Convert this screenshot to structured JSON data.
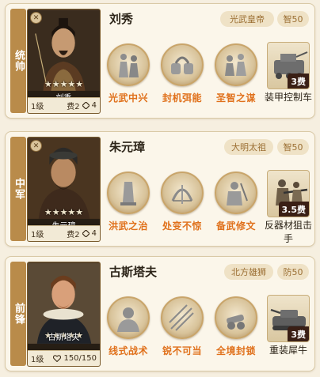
{
  "generals": [
    {
      "position": "统帅",
      "name": "刘秀",
      "stars": "★★★★★",
      "level": "1级",
      "cost_text": "费2",
      "extra_text": "4",
      "extra_icon": "troop-icon",
      "title": "光武皇帝",
      "stat": "智50",
      "skills": [
        {
          "label": "光武中兴",
          "icon": "statue-figures-icon"
        },
        {
          "label": "封机弭能",
          "icon": "shackles-icon"
        },
        {
          "label": "圣智之谋",
          "icon": "council-figures-icon"
        }
      ],
      "unit": {
        "label": "装甲控制车",
        "cost": "3费",
        "icon": "armored-vehicle-icon"
      }
    },
    {
      "position": "中军",
      "name": "朱元璋",
      "stars": "★★★★★",
      "level": "1级",
      "cost_text": "费2",
      "extra_text": "4",
      "extra_icon": "troop-icon",
      "title": "大明太祖",
      "stat": "智50",
      "skills": [
        {
          "label": "洪武之治",
          "icon": "stele-icon"
        },
        {
          "label": "处变不惊",
          "icon": "bow-icon"
        },
        {
          "label": "备武修文",
          "icon": "armored-figure-icon"
        }
      ],
      "unit": {
        "label": "反器材狙击手",
        "cost": "3.5费",
        "icon": "sniper-icon"
      }
    },
    {
      "position": "前锋",
      "name": "古斯塔夫",
      "stars": "★★★★★",
      "level": "1级",
      "cost_text": "",
      "extra_text": "150/150",
      "extra_icon": "heart-icon",
      "title": "北方雄狮",
      "stat": "防50",
      "skills": [
        {
          "label": "线式战术",
          "icon": "soldier-bust-icon"
        },
        {
          "label": "锐不可当",
          "icon": "arrow-volley-icon"
        },
        {
          "label": "全境封锁",
          "icon": "cannon-icon"
        }
      ],
      "unit": {
        "label": "重装犀牛",
        "cost": "3费",
        "icon": "heavy-tank-icon"
      }
    }
  ],
  "colors": {
    "accent": "#b98b4a",
    "skill_label": "#e0711c",
    "tag_text": "#9b6f33",
    "tag_bg": "#efe2c6"
  }
}
